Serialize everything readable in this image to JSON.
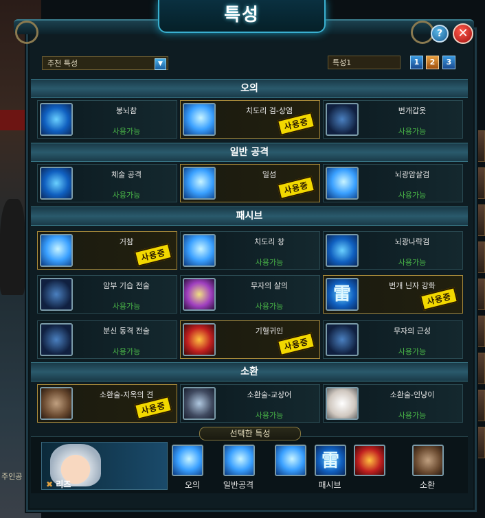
{
  "window": {
    "title": "특성"
  },
  "controls": {
    "recommend_select": "추천 특성",
    "preset_name": "특성1",
    "pages": [
      "1",
      "2",
      "3"
    ],
    "active_page": "2"
  },
  "sections": [
    {
      "title": "오의",
      "cards": [
        {
          "name": "봉뇌참",
          "status": "사용가능",
          "used": false,
          "icon": "lightning-blade-icon"
        },
        {
          "name": "치도리 검-상염",
          "status": "사용중",
          "used": true,
          "icon": "chidori-sword-icon"
        },
        {
          "name": "번개갑옷",
          "status": "사용가능",
          "used": false,
          "icon": "lightning-armor-icon"
        }
      ]
    },
    {
      "title": "일반 공격",
      "cards": [
        {
          "name": "체술 공격",
          "status": "사용가능",
          "used": false,
          "icon": "fist-icon"
        },
        {
          "name": "일섬",
          "status": "사용중",
          "used": true,
          "icon": "flash-slash-icon"
        },
        {
          "name": "뇌광암살검",
          "status": "사용가능",
          "used": false,
          "icon": "cross-blades-icon"
        }
      ]
    },
    {
      "title": "패시브",
      "cards": [
        {
          "name": "거참",
          "status": "사용중",
          "used": true,
          "icon": "slash-wave-icon"
        },
        {
          "name": "치도리 창",
          "status": "사용가능",
          "used": false,
          "icon": "chidori-spear-icon"
        },
        {
          "name": "뇌광나락검",
          "status": "사용가능",
          "used": false,
          "icon": "falling-blade-icon"
        },
        {
          "name": "암부 기습 전술",
          "status": "사용가능",
          "used": false,
          "icon": "anbu-silhouette-icon"
        },
        {
          "name": "무자의 살의",
          "status": "사용가능",
          "used": false,
          "icon": "crescent-slash-icon"
        },
        {
          "name": "번개 닌자 강화",
          "status": "사용중",
          "used": true,
          "icon": "thunder-kanji-icon"
        },
        {
          "name": "분신 동격 전술",
          "status": "사용가능",
          "used": false,
          "icon": "clones-icon"
        },
        {
          "name": "기혈귀인",
          "status": "사용중",
          "used": true,
          "icon": "red-demon-icon"
        },
        {
          "name": "무자의 근성",
          "status": "사용가능",
          "used": false,
          "icon": "blue-figure-icon"
        }
      ]
    },
    {
      "title": "소환",
      "cards": [
        {
          "name": "소환술-지옥의 견",
          "status": "사용중",
          "used": true,
          "icon": "hell-hound-icon"
        },
        {
          "name": "소환술-교상어",
          "status": "사용가능",
          "used": false,
          "icon": "shark-icon"
        },
        {
          "name": "소환술-인냥이",
          "status": "사용가능",
          "used": false,
          "icon": "ninja-cat-icon"
        }
      ]
    }
  ],
  "selected": {
    "title": "선택한 특성",
    "character": {
      "name": "리즈"
    },
    "groups": [
      {
        "label": "오의"
      },
      {
        "label": "일반공격"
      },
      {
        "label": "패시브"
      },
      {
        "label": "소환"
      }
    ]
  },
  "background": {
    "left_label": "주인공"
  }
}
